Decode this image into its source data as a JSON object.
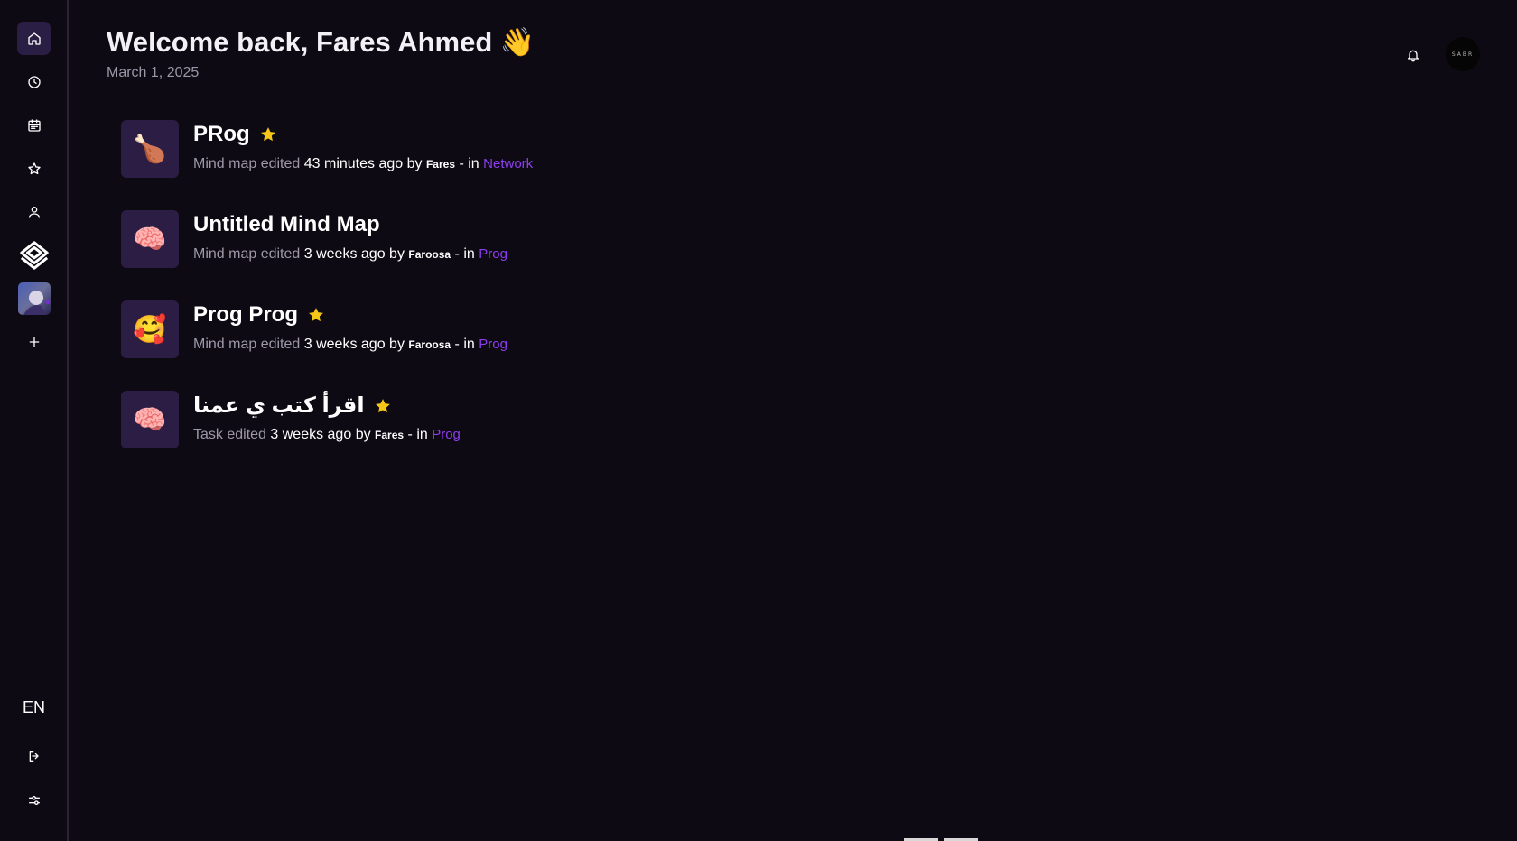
{
  "header": {
    "title": "Welcome back, Fares Ahmed 👋",
    "date": "March 1, 2025"
  },
  "sidebar": {
    "items": [
      {
        "icon": "home-icon"
      },
      {
        "icon": "clock-icon"
      },
      {
        "icon": "calendar-icon"
      },
      {
        "icon": "star-icon"
      },
      {
        "icon": "user-icon"
      },
      {
        "icon": "workspace-logo-icon"
      },
      {
        "icon": "workspace-avatar-icon"
      },
      {
        "icon": "plus-icon"
      }
    ],
    "language": "EN"
  },
  "topbar": {
    "avatar_text": "SABR"
  },
  "recent": [
    {
      "emoji": "🍗",
      "title": "PRog",
      "starred": true,
      "action": "Mind map edited",
      "time": "43 minutes ago",
      "by": "by",
      "author": "Fares",
      "dash": "-",
      "in": "in",
      "workspace": "Network"
    },
    {
      "emoji": "🧠",
      "title": "Untitled Mind Map",
      "starred": false,
      "action": "Mind map edited",
      "time": "3 weeks ago",
      "by": "by",
      "author": "Faroosa",
      "dash": "-",
      "in": "in",
      "workspace": "Prog"
    },
    {
      "emoji": "🥰",
      "title": "Prog Prog",
      "starred": true,
      "action": "Mind map edited",
      "time": "3 weeks ago",
      "by": "by",
      "author": "Faroosa",
      "dash": "-",
      "in": "in",
      "workspace": "Prog"
    },
    {
      "emoji": "🧠",
      "title": "اقرأ كتب ي عمنا",
      "starred": true,
      "action": "Task edited",
      "time": "3 weeks ago",
      "by": "by",
      "author": "Fares",
      "dash": "-",
      "in": "in",
      "workspace": "Prog"
    }
  ],
  "colors": {
    "background": "#0d0a13",
    "accent": "#8f3df0",
    "thumb": "#2c1d45",
    "star": "#f5c518"
  }
}
